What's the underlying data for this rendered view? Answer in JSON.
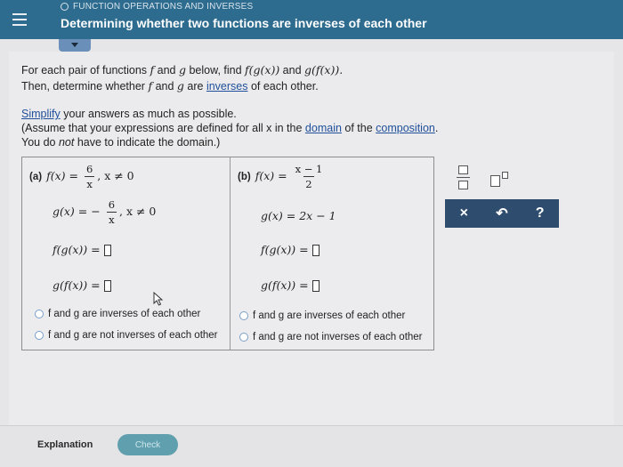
{
  "header": {
    "section": "FUNCTION OPERATIONS AND INVERSES",
    "title": "Determining whether two functions are inverses of each other"
  },
  "intro": {
    "line1_pre": "For each pair of functions ",
    "f": "f",
    "and": " and ",
    "g": "g",
    "line1_mid": " below, find ",
    "fg": "f(g(x))",
    "and2": " and ",
    "gf": "g(f(x)).",
    "line2_pre": "Then, determine whether ",
    "line2_mid": " are ",
    "inverses_link": "inverses",
    "line2_post": " of each other."
  },
  "note": {
    "simplify_link": "Simplify",
    "simplify_post": " your answers as much as possible.",
    "assume_pre": "(Assume that your expressions are defined for all x in the ",
    "domain_link": "domain",
    "assume_mid": " of the ",
    "composition_link": "composition",
    "assume_post": ".",
    "line3_pre": "You do ",
    "line3_not": "not",
    "line3_post": " have to indicate the domain.)"
  },
  "part_a": {
    "tag": "(a)",
    "f_lhs": "f(x) =",
    "f_num": "6",
    "f_den": "x",
    "f_cond": ",  x ≠ 0",
    "g_lhs": "g(x) = −",
    "g_num": "6",
    "g_den": "x",
    "g_cond": ",  x ≠ 0",
    "fg_label": "f(g(x)) =",
    "gf_label": "g(f(x)) =",
    "option1": "f and g are inverses of each other",
    "option2": "f and g are not inverses of each other"
  },
  "part_b": {
    "tag": "(b)",
    "f_lhs": "f(x) =",
    "f_num": "x − 1",
    "f_den": "2",
    "g_expr": "g(x) = 2x − 1",
    "fg_label": "f(g(x)) =",
    "gf_label": "g(f(x)) =",
    "option1": "f and g are inverses of each other",
    "option2": "f and g are not inverses of each other"
  },
  "tools": {
    "clear": "×",
    "undo": "↶",
    "help": "?"
  },
  "footer": {
    "explanation": "Explanation",
    "check": "Check"
  },
  "colors": {
    "header_bg": "#2d6b8f",
    "toolbar_bg": "#2e4d6e",
    "link": "#1f4f9b",
    "check_bg": "#5f9fae"
  }
}
